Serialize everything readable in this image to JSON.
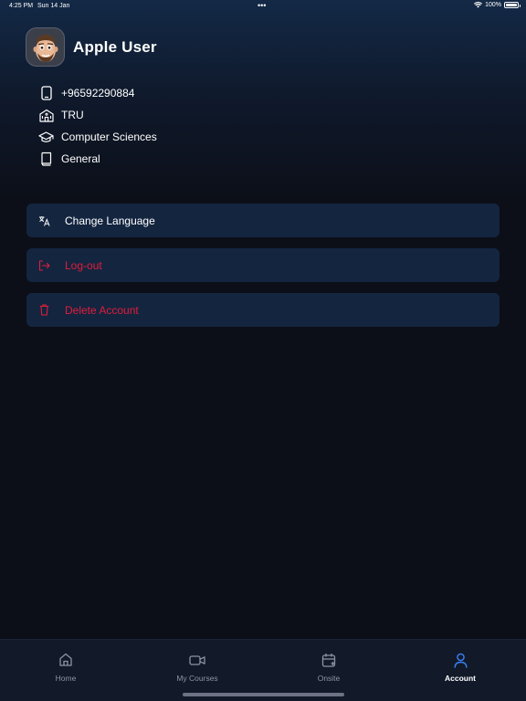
{
  "status_bar": {
    "time": "4:25 PM",
    "date": "Sun 14 Jan",
    "battery": "100%",
    "battery_level": 1.0
  },
  "profile": {
    "name": "Apple User",
    "avatar_icon": "memoji-avatar"
  },
  "info": {
    "phone": {
      "icon": "phone-icon",
      "value": "+96592290884"
    },
    "university": {
      "icon": "building-icon",
      "value": "TRU"
    },
    "major": {
      "icon": "graduation-cap-icon",
      "value": "Computer Sciences"
    },
    "level": {
      "icon": "book-icon",
      "value": "General"
    }
  },
  "menu": {
    "change_language": {
      "label": "Change Language",
      "icon": "translate-icon",
      "color": "#ffffff"
    },
    "logout": {
      "label": "Log-out",
      "icon": "logout-icon",
      "color": "#e11d3a"
    },
    "delete_account": {
      "label": "Delete Account",
      "icon": "trash-icon",
      "color": "#e11d3a"
    }
  },
  "tabs": [
    {
      "label": "Home",
      "icon": "home-icon",
      "active": false
    },
    {
      "label": "My Courses",
      "icon": "video-camera-icon",
      "active": false
    },
    {
      "label": "Onsite",
      "icon": "calendar-add-icon",
      "active": false
    },
    {
      "label": "Account",
      "icon": "user-icon",
      "active": true
    }
  ],
  "colors": {
    "background": "#0c0f18",
    "menu_background": "#142540",
    "danger": "#e11d3a",
    "accent": "#3b82f6",
    "tab_inactive": "#8c93a3"
  }
}
